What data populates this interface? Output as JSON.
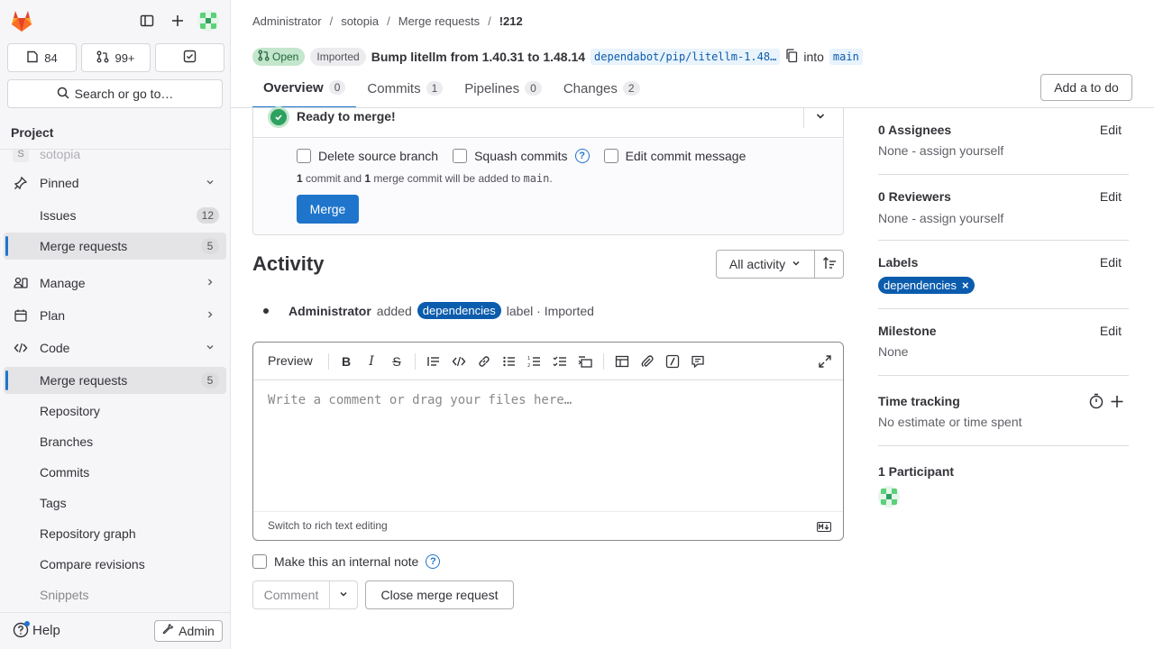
{
  "sidebar": {
    "counters": {
      "issues": "84",
      "merge_requests": "99+"
    },
    "search_label": "Search or go to…",
    "section_title": "Project",
    "project_name": "sotopia",
    "items": [
      {
        "label": "Pinned"
      },
      {
        "label": "Issues",
        "badge": "12"
      },
      {
        "label": "Merge requests",
        "badge": "5"
      },
      {
        "label": "Manage"
      },
      {
        "label": "Plan"
      },
      {
        "label": "Code"
      },
      {
        "label": "Merge requests",
        "badge": "5"
      },
      {
        "label": "Repository"
      },
      {
        "label": "Branches"
      },
      {
        "label": "Commits"
      },
      {
        "label": "Tags"
      },
      {
        "label": "Repository graph"
      },
      {
        "label": "Compare revisions"
      },
      {
        "label": "Snippets"
      }
    ],
    "help_label": "Help",
    "admin_label": "Admin"
  },
  "breadcrumb": [
    "Administrator",
    "sotopia",
    "Merge requests",
    "!212"
  ],
  "mr": {
    "status": "Open",
    "imported": "Imported",
    "title": "Bump litellm from 1.40.31 to 1.48.14",
    "source_branch": "dependabot/pip/litellm-1.48…",
    "into": "into",
    "target_branch": "main"
  },
  "tabs": [
    {
      "label": "Overview",
      "count": "0"
    },
    {
      "label": "Commits",
      "count": "1"
    },
    {
      "label": "Pipelines",
      "count": "0"
    },
    {
      "label": "Changes",
      "count": "2"
    }
  ],
  "todo_label": "Add a to do",
  "widget": {
    "status": "Ready to merge!",
    "options": [
      "Delete source branch",
      "Squash commits",
      "Edit commit message"
    ],
    "note": {
      "n1": "1",
      "t1": " commit and ",
      "n2": "1",
      "t2": " merge commit will be added to ",
      "branch": "main",
      "t3": "."
    },
    "merge_label": "Merge"
  },
  "activity": {
    "title": "Activity",
    "filter": "All activity",
    "event": {
      "author": "Administrator",
      "verb": "added",
      "label": "dependencies",
      "suffix": "label · Imported"
    }
  },
  "editor": {
    "preview": "Preview",
    "placeholder": "Write a comment or drag your files here…",
    "switch_label": "Switch to rich text editing",
    "internal_note": "Make this an internal note",
    "comment_label": "Comment",
    "close_label": "Close merge request"
  },
  "right": {
    "assignees_title": "0 Assignees",
    "assignees_value": "None - assign yourself",
    "reviewers_title": "0 Reviewers",
    "reviewers_value": "None - assign yourself",
    "labels_title": "Labels",
    "label_chip": "dependencies",
    "milestone_title": "Milestone",
    "milestone_value": "None",
    "time_title": "Time tracking",
    "time_value": "No estimate or time spent",
    "participants_title": "1 Participant",
    "edit_label": "Edit"
  },
  "colors": {
    "primary": "#1f75cb",
    "success": "#2da160",
    "label": "#0b5cad",
    "logo": "#e24329"
  }
}
